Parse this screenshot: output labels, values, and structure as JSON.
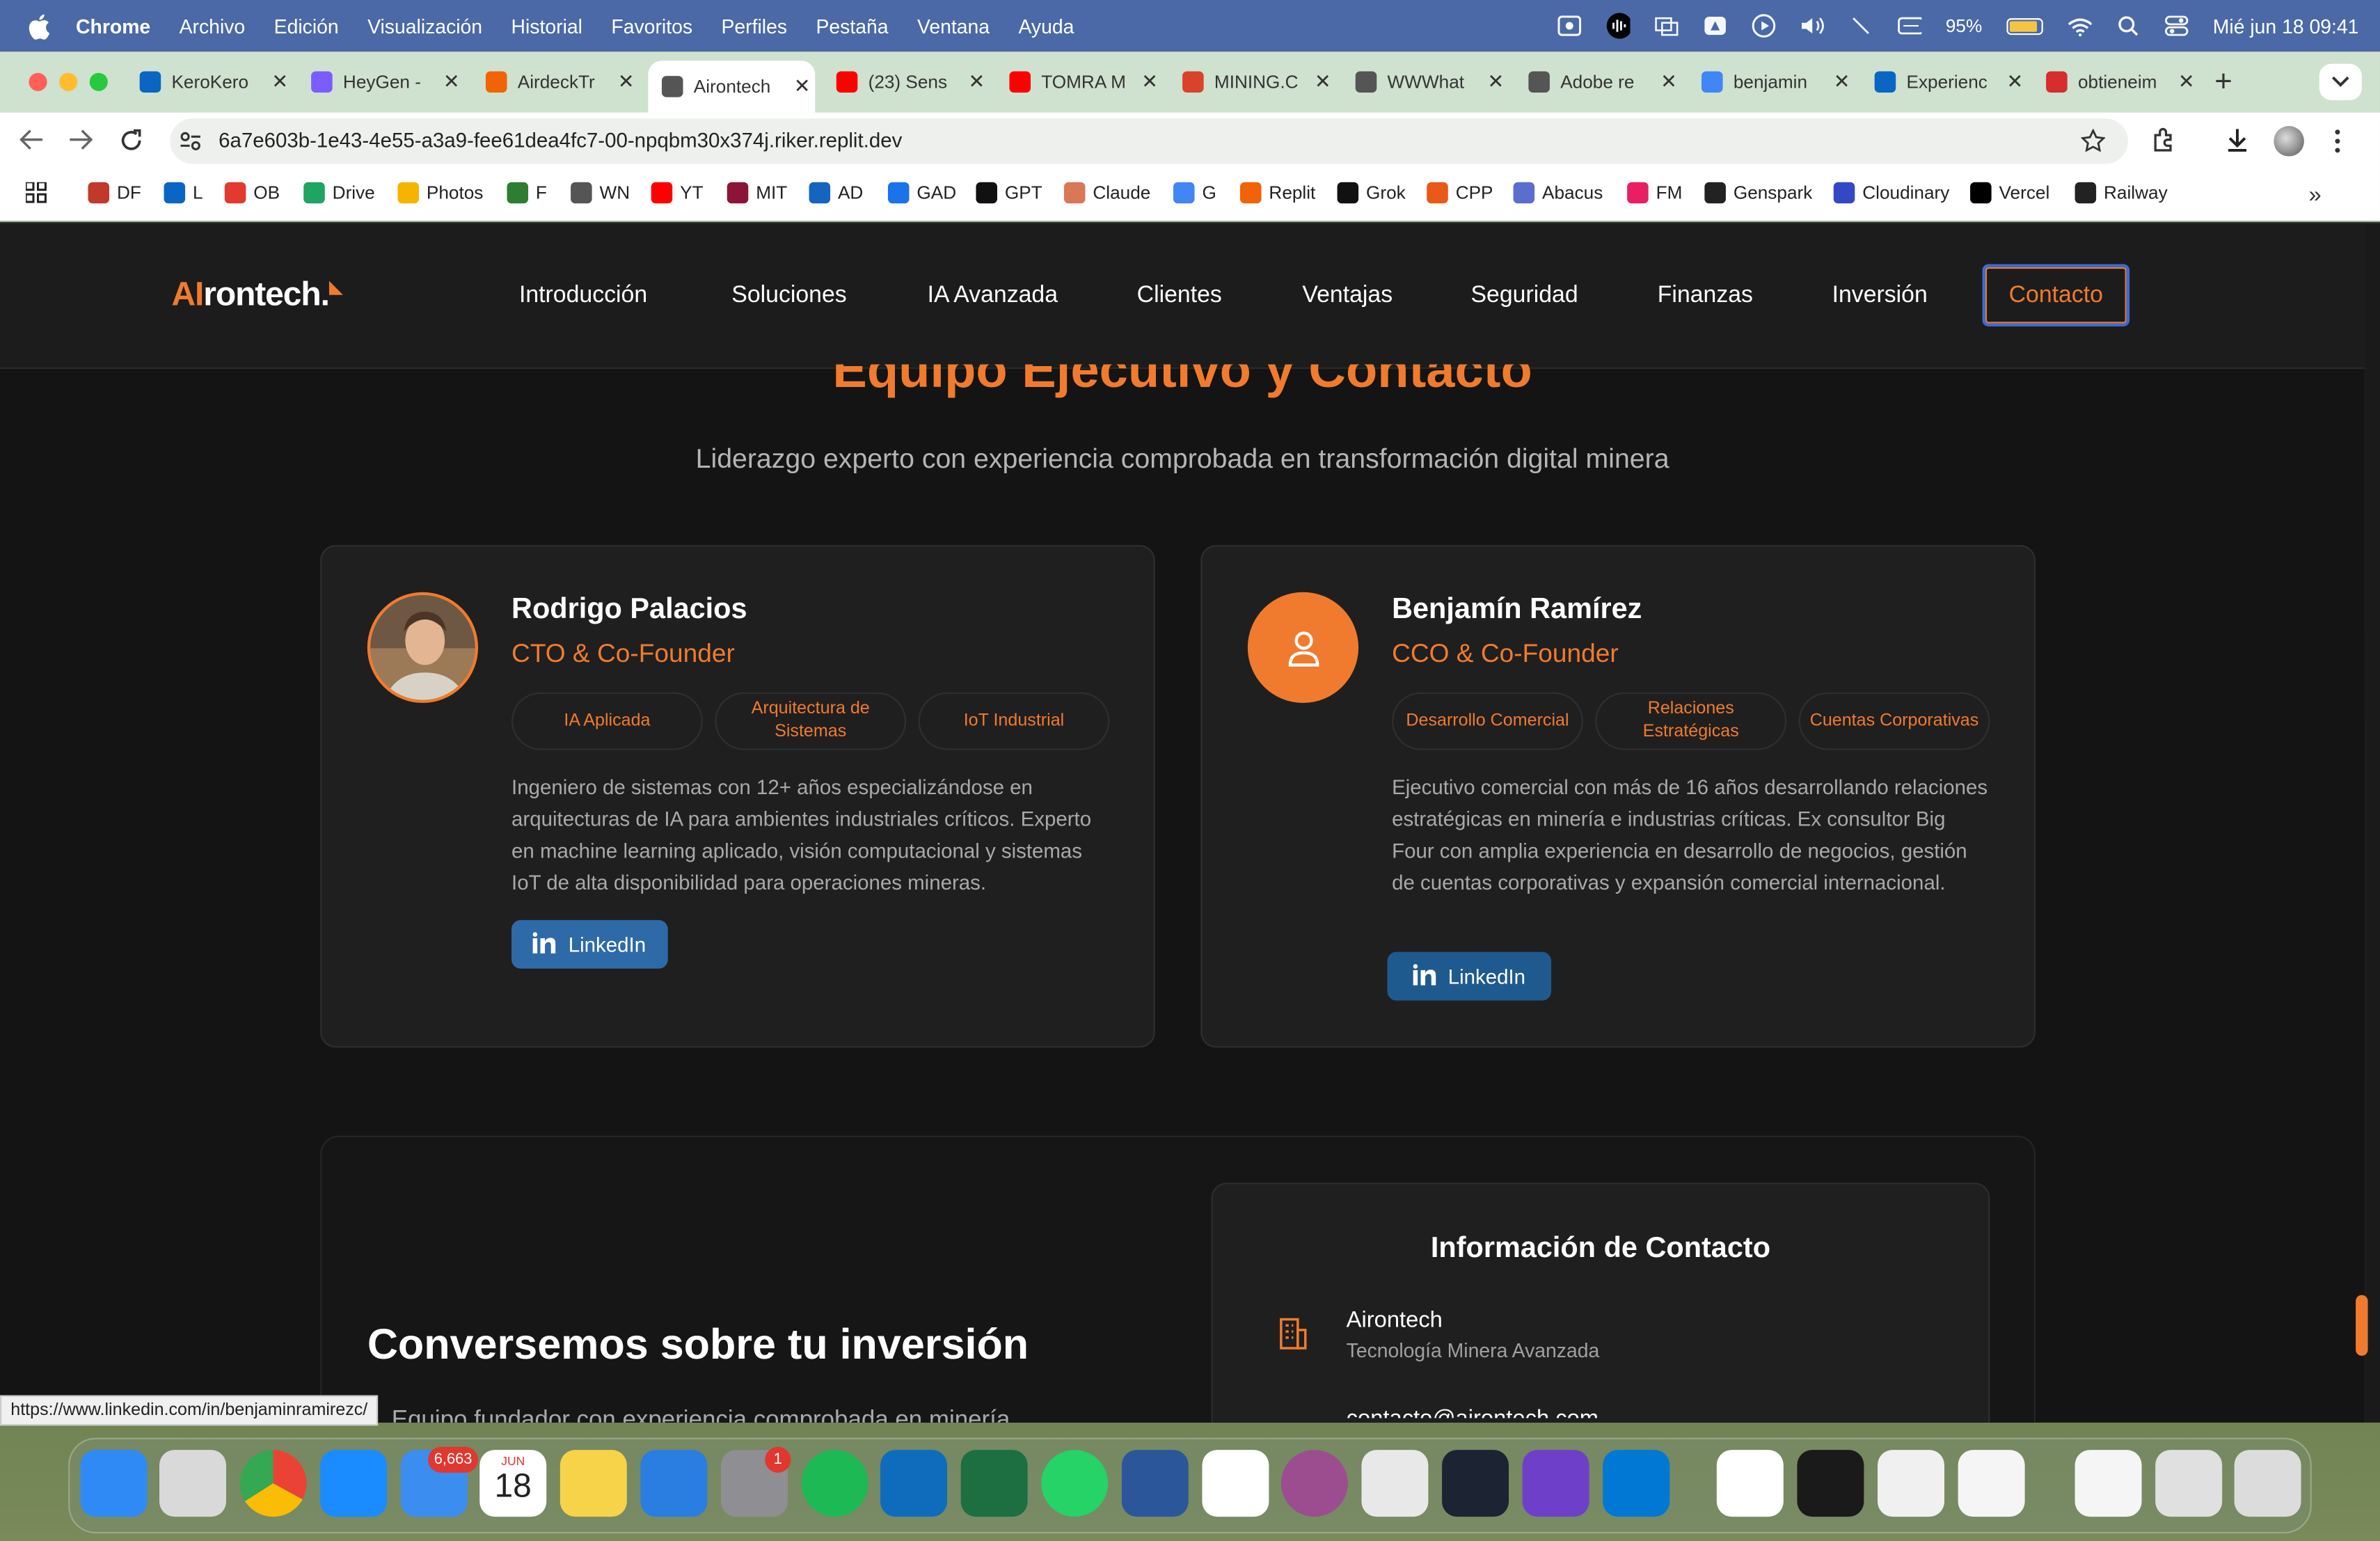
{
  "menubar": {
    "app": "Chrome",
    "items": [
      "Archivo",
      "Edición",
      "Visualización",
      "Historial",
      "Favoritos",
      "Perfiles",
      "Pestaña",
      "Ventana",
      "Ayuda"
    ],
    "battery": "95%",
    "clock": "Mié jun 18  09:41"
  },
  "tabs": [
    {
      "label": "KeroKero",
      "icon": "linkedin-icon",
      "color": "#0a66c2"
    },
    {
      "label": "HeyGen -",
      "icon": "heygen-icon",
      "color": "#7b5cff"
    },
    {
      "label": "AirdeckTr",
      "icon": "replit-icon",
      "color": "#f26207"
    },
    {
      "label": "Airontech",
      "icon": "globe-icon",
      "color": "#555555"
    },
    {
      "label": "(23) Sens",
      "icon": "youtube-icon",
      "color": "#ff0000"
    },
    {
      "label": "TOMRA M",
      "icon": "youtube-icon",
      "color": "#ff0000"
    },
    {
      "label": "MINING.C",
      "icon": "mining-icon",
      "color": "#d9432b"
    },
    {
      "label": "WWWhat",
      "icon": "page-icon",
      "color": "#555555"
    },
    {
      "label": "Adobe re",
      "icon": "page-icon",
      "color": "#555555"
    },
    {
      "label": "benjamin",
      "icon": "google-icon",
      "color": "#4285f4"
    },
    {
      "label": "Experienc",
      "icon": "linkedin-icon",
      "color": "#0a66c2"
    },
    {
      "label": "obtieneim",
      "icon": "star-icon",
      "color": "#d62d2d"
    }
  ],
  "address": {
    "url": "6a7e603b-1e43-4e55-a3a9-fee61dea4fc7-00-npqbm30x374j.riker.replit.dev"
  },
  "bookmarks": [
    {
      "label": "DF",
      "color": "#c0392b"
    },
    {
      "label": "L",
      "color": "#0a66c2"
    },
    {
      "label": "OB",
      "color": "#e23a2e"
    },
    {
      "label": "Drive",
      "color": "#1fa463"
    },
    {
      "label": "Photos",
      "color": "#f4b400"
    },
    {
      "label": "F",
      "color": "#2e7d32"
    },
    {
      "label": "WN",
      "color": "#555555"
    },
    {
      "label": "YT",
      "color": "#ff0000"
    },
    {
      "label": "MIT",
      "color": "#8a1538"
    },
    {
      "label": "AD",
      "color": "#1565c0"
    },
    {
      "label": "GAD",
      "color": "#1a73e8"
    },
    {
      "label": "GPT",
      "color": "#111111"
    },
    {
      "label": "Claude",
      "color": "#d97757"
    },
    {
      "label": "G",
      "color": "#4285f4"
    },
    {
      "label": "Replit",
      "color": "#f26207"
    },
    {
      "label": "Grok",
      "color": "#111111"
    },
    {
      "label": "CPP",
      "color": "#e8591a"
    },
    {
      "label": "Abacus",
      "color": "#5b6dcd"
    },
    {
      "label": "FM",
      "color": "#e91e63"
    },
    {
      "label": "Genspark",
      "color": "#222222"
    },
    {
      "label": "Cloudinary",
      "color": "#3448c5"
    },
    {
      "label": "Vercel",
      "color": "#000000"
    },
    {
      "label": "Railway",
      "color": "#222222"
    }
  ],
  "site": {
    "logo_ai": "AI",
    "logo_rest": "rontech.",
    "nav": [
      "Introducción",
      "Soluciones",
      "IA Avanzada",
      "Clientes",
      "Ventajas",
      "Seguridad",
      "Finanzas",
      "Inversión"
    ],
    "nav_cta": "Contacto",
    "section_title": "Equipo Ejecutivo y Contacto",
    "section_subtitle": "Liderazgo experto con experiencia comprobada en transformación digital minera",
    "team": [
      {
        "name": "Rodrigo Palacios",
        "role": "CTO & Co-Founder",
        "tags": [
          "IA Aplicada",
          "Arquitectura de Sistemas",
          "IoT Industrial"
        ],
        "bio": "Ingeniero de sistemas con 12+ años especializándose en arquitecturas de IA para ambientes industriales críticos. Experto en machine learning aplicado, visión computacional y sistemas IoT de alta disponibilidad para operaciones mineras.",
        "button": "LinkedIn"
      },
      {
        "name": "Benjamín Ramírez",
        "role": "CCO & Co-Founder",
        "tags": [
          "Desarrollo Comercial",
          "Relaciones Estratégicas",
          "Cuentas Corporativas"
        ],
        "bio": "Ejecutivo comercial con más de 16 años desarrollando relaciones estratégicas en minería e industrias críticas. Ex consultor Big Four con amplia experiencia en desarrollo de negocios, gestión de cuentas corporativas y expansión comercial internacional.",
        "button": "LinkedIn"
      }
    ],
    "contact_title": "Conversemos sobre tu inversión",
    "contact_text": "Equipo fundador con experiencia comprobada en minería",
    "info_title": "Información de Contacto",
    "company": "Airontech",
    "company_sub": "Tecnología Minera Avanzada",
    "email": "contacto@airontech.com",
    "accent": "#f07b2e"
  },
  "status_url": "https://www.linkedin.com/in/benjaminramirezc/",
  "dock": {
    "mail_badge": "6,663",
    "calendar_month": "JUN",
    "calendar_day": "18",
    "settings_badge": "1",
    "apps": [
      {
        "name": "finder",
        "color": "#2f8af5"
      },
      {
        "name": "launchpad",
        "color": "#d9d9d9"
      },
      {
        "name": "chrome",
        "color": "#ffffff"
      },
      {
        "name": "safari",
        "color": "#1a8cff"
      },
      {
        "name": "mail",
        "color": "#3b8df0"
      },
      {
        "name": "calendar",
        "color": "#ffffff"
      },
      {
        "name": "notes",
        "color": "#f7d34a"
      },
      {
        "name": "keynote",
        "color": "#2a7de1"
      },
      {
        "name": "system-settings",
        "color": "#8e8e93"
      },
      {
        "name": "spotify",
        "color": "#1db954"
      },
      {
        "name": "outlook",
        "color": "#0f6cbd"
      },
      {
        "name": "excel",
        "color": "#1d6f42"
      },
      {
        "name": "whatsapp",
        "color": "#25d366"
      },
      {
        "name": "word",
        "color": "#2b579a"
      },
      {
        "name": "calendar-31",
        "color": "#ffffff"
      },
      {
        "name": "screen-recorder",
        "color": "#9b4d8f"
      },
      {
        "name": "iphone-mirroring",
        "color": "#e8e8e8"
      },
      {
        "name": "replit",
        "color": "#1c2333"
      },
      {
        "name": "github-desktop",
        "color": "#6e40c9"
      },
      {
        "name": "vscode",
        "color": "#0078d4"
      },
      {
        "name": "notion",
        "color": "#ffffff"
      },
      {
        "name": "webex",
        "color": "#1a1a1a"
      },
      {
        "name": "app-store-installer",
        "color": "#f0f0f0"
      },
      {
        "name": "textedit",
        "color": "#f5f5f5"
      },
      {
        "name": "txt-document",
        "color": "#f5f5f5"
      },
      {
        "name": "screenshot",
        "color": "#e0e0e0"
      },
      {
        "name": "trash",
        "color": "#dcdcdc"
      }
    ]
  }
}
